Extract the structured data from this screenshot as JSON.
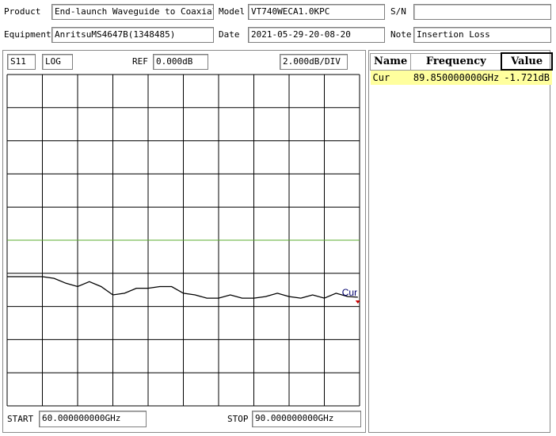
{
  "header": {
    "product_label": "Product",
    "product_value": "End-launch Waveguide to Coaxial",
    "model_label": "Model",
    "model_value": "VT740WECA1.0KPC",
    "sn_label": "S/N",
    "sn_value": "",
    "equipment_label": "Equipment",
    "equipment_value": "AnritsuMS4647B(1348485)",
    "date_label": "Date",
    "date_value": "2021-05-29-20-08-20",
    "note_label": "Note",
    "note_value": "Insertion Loss"
  },
  "chart_controls": {
    "param": "S11",
    "format": "LOG",
    "ref_label": "REF",
    "ref_value": "0.000dB",
    "scale": "2.000dB/DIV",
    "start_label": "START",
    "start_value": "60.000000000GHz",
    "stop_label": "STOP",
    "stop_value": "90.000000000GHz"
  },
  "marker_table": {
    "headers": [
      "Name",
      "Frequency",
      "Value"
    ],
    "rows": [
      {
        "name": "Cur",
        "frequency": "89.850000000GHz",
        "value": "-1.721dB"
      }
    ]
  },
  "colors": {
    "reference_line": "#5aab2e",
    "trace": "#000000",
    "marker_label": "#00006e",
    "marker_pointer": "#cc0000",
    "marker_row_bg": "#ffff9e"
  },
  "chart_data": {
    "type": "line",
    "x_unit": "GHz",
    "y_unit": "dB",
    "xlim": [
      60,
      90
    ],
    "ylim": [
      -10,
      0
    ],
    "grid": true,
    "x_divisions": 10,
    "y_divisions": 10,
    "reference_level": 0,
    "series": [
      {
        "x": [
          60,
          61,
          62,
          63,
          64,
          65,
          66,
          67,
          68,
          69,
          70,
          71,
          72,
          73,
          74,
          75,
          76,
          77,
          78,
          79,
          80,
          81,
          82,
          83,
          84,
          85,
          86,
          87,
          88,
          89,
          89.85
        ],
        "y": [
          -1.1,
          -1.1,
          -1.1,
          -1.1,
          -1.15,
          -1.3,
          -1.4,
          -1.25,
          -1.4,
          -1.65,
          -1.6,
          -1.45,
          -1.45,
          -1.4,
          -1.4,
          -1.6,
          -1.65,
          -1.75,
          -1.75,
          -1.65,
          -1.75,
          -1.75,
          -1.7,
          -1.6,
          -1.7,
          -1.75,
          -1.65,
          -1.75,
          -1.6,
          -1.7,
          -1.72
        ]
      }
    ],
    "marker": {
      "name": "Cur",
      "x": 89.85,
      "y": -1.721
    }
  }
}
